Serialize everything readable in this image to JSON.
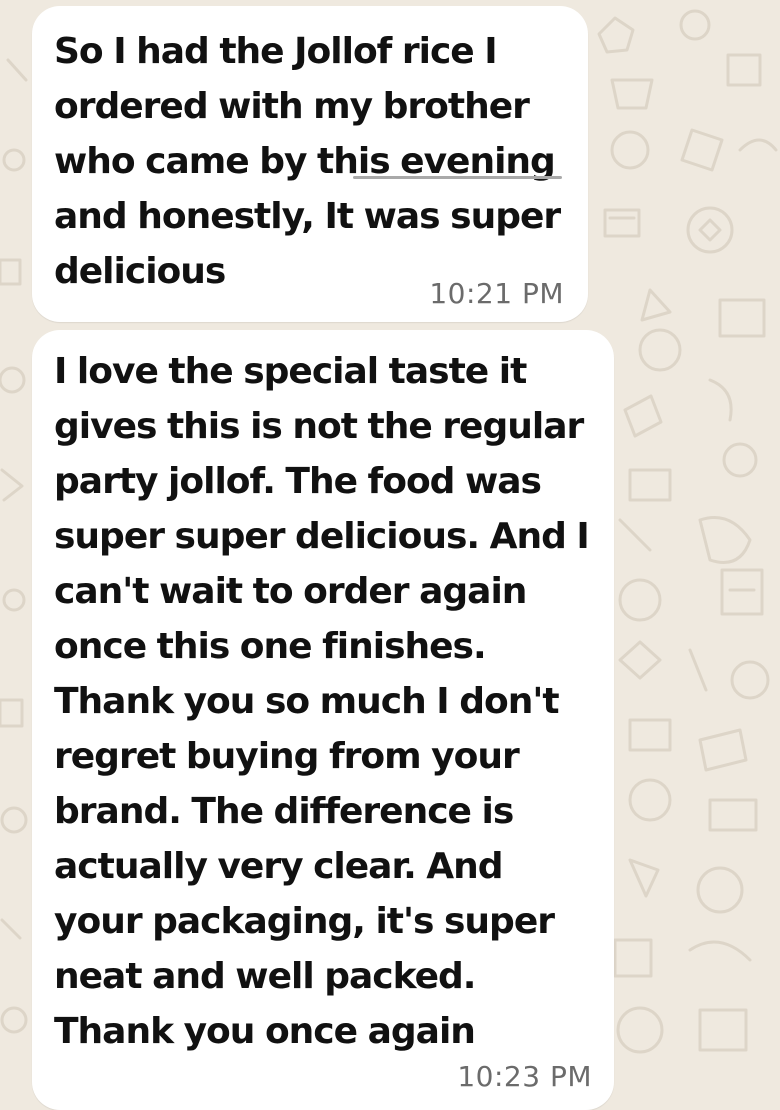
{
  "chat": {
    "background_color": "#efe9df",
    "bubble_color": "#ffffff",
    "messages": [
      {
        "text": "So I had the Jollof rice I\nordered with my brother\nwho came by this evening\nand honestly, It was super\ndelicious",
        "linked_text": "this evening",
        "time": "10:21 PM"
      },
      {
        "text": "I love the special taste it\ngives this is not the regular\nparty jollof. The food was\nsuper super delicious. And I\ncan't wait to order again\nonce this one finishes.\nThank you so much I don't\nregret buying from your\nbrand. The difference is\nactually very clear. And\nyour packaging, it's super\nneat and well packed.\nThank you once again",
        "time": "10:23 PM"
      }
    ]
  }
}
